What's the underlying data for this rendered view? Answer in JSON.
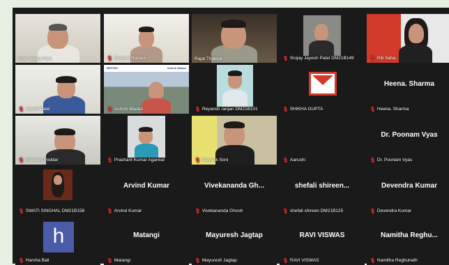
{
  "window": {
    "title": "Video meeting gallery view"
  },
  "colors": {
    "grid_bg": "#1a1a1a",
    "mic_muted": "#e23333",
    "active_speaker": "#e8e030",
    "page_bg": "#e6efe2"
  },
  "participants": [
    {
      "label": "Prof. Manoj Pant",
      "muted": false,
      "video": true
    },
    {
      "label": "Deepak Rahani",
      "muted": true,
      "video": true
    },
    {
      "label": "Rajat Thakkar",
      "muted": false,
      "video": true
    },
    {
      "label": "Srujay Jayesh Patel DM21B149",
      "muted": true,
      "video": true
    },
    {
      "label": "Riti Saha",
      "muted": true,
      "video": true
    },
    {
      "label": "Akash Patel",
      "muted": true,
      "video": true
    },
    {
      "label": "Ashish Madan",
      "muted": true,
      "video": true
    },
    {
      "label": "Reyansh ranjan DM21B101",
      "muted": true,
      "video": true
    },
    {
      "label": "SHIKHA GUPTA",
      "muted": true,
      "video": true
    },
    {
      "label": "Heena. Sharma",
      "display": "Heena. Sharma",
      "muted": true,
      "video": false
    },
    {
      "label": "Rishabh Poddar",
      "muted": true,
      "video": true
    },
    {
      "label": "Prashant Kumar Agarwal",
      "muted": true,
      "video": true
    },
    {
      "label": "Mayank Soni",
      "muted": true,
      "video": true
    },
    {
      "label": "Aarushi",
      "muted": true,
      "video": false
    },
    {
      "label": "Dr. Poonam Vyas",
      "display": "Dr. Poonam Vyas",
      "muted": true,
      "video": false
    },
    {
      "label": "SWATI SINGHAL DM21B158",
      "muted": true,
      "video": true
    },
    {
      "label": "Arvind Kumar",
      "display": "Arvind Kumar",
      "muted": true,
      "video": false
    },
    {
      "label": "Vivekananda Ghosh",
      "display": "Vivekananda Gh...",
      "muted": true,
      "video": false
    },
    {
      "label": "shefali shireen DM21B125",
      "display": "shefali shireen...",
      "muted": true,
      "video": false
    },
    {
      "label": "Devendra Kumar",
      "display": "Devendra Kumar",
      "muted": true,
      "video": false
    },
    {
      "label": "Harsha Bali",
      "avatar_letter": "h",
      "muted": true,
      "video": false
    },
    {
      "label": "Matangi",
      "display": "Matangi",
      "muted": true,
      "video": false
    },
    {
      "label": "Mayuresh Jagtap",
      "display": "Mayuresh Jagtap",
      "muted": true,
      "video": false
    },
    {
      "label": "RAVI VISWAS",
      "display": "RAVI VISWAS",
      "muted": true,
      "video": false
    },
    {
      "label": "Namitha Reghunath",
      "display": "Namitha Reghu...",
      "muted": true,
      "video": false
    }
  ],
  "banner": {
    "left": "BRITISH",
    "right": "Ashish Madan"
  }
}
